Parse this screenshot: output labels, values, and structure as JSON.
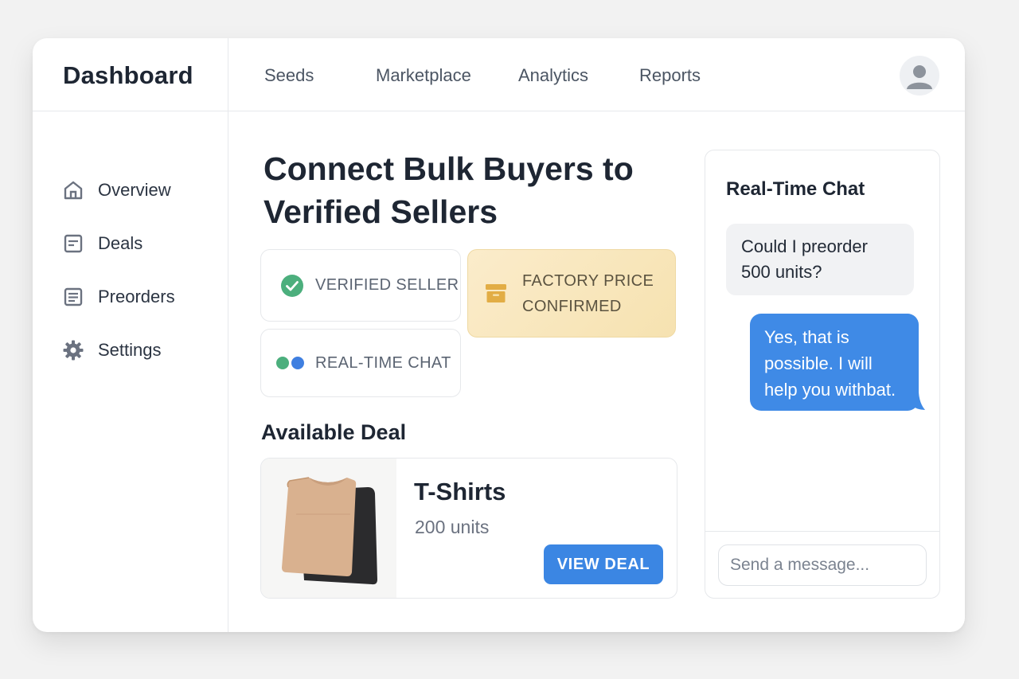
{
  "app": {
    "title": "Dashboard"
  },
  "topnav": {
    "items": [
      {
        "label": "Seeds"
      },
      {
        "label": "Marketplace"
      },
      {
        "label": "Analytics"
      },
      {
        "label": "Reports"
      }
    ]
  },
  "sidebar": {
    "items": [
      {
        "label": "Overview",
        "icon": "home-icon"
      },
      {
        "label": "Deals",
        "icon": "document-icon"
      },
      {
        "label": "Preorders",
        "icon": "list-icon"
      },
      {
        "label": "Settings",
        "icon": "gear-icon"
      }
    ]
  },
  "hero": {
    "line1": "Connect Bulk Buyers to",
    "line2": "Verified Sellers"
  },
  "badges": {
    "verified": "VERIFIED SELLER",
    "factory_line1": "FACTORY PRICE",
    "factory_line2": "CONFIRMED",
    "chat": "REAL-TIME CHAT"
  },
  "deal": {
    "section_title": "Available Deal",
    "title": "T-Shirts",
    "units": "200 units",
    "button": "VIEW DEAL",
    "image": "folded-tshirts"
  },
  "chat": {
    "title": "Real-Time Chat",
    "messages": [
      {
        "from": "buyer",
        "lines": [
          "Could I preorder",
          "500 units?"
        ]
      },
      {
        "from": "seller",
        "lines": [
          "Yes, that is",
          "possible. I will",
          "help you withbat."
        ]
      }
    ],
    "input_placeholder": "Send a message..."
  },
  "colors": {
    "accent": "#3b86e3",
    "success": "#4caf7d",
    "gold_badge": "#f6e2b0",
    "gold_icon": "#e2ad45"
  }
}
